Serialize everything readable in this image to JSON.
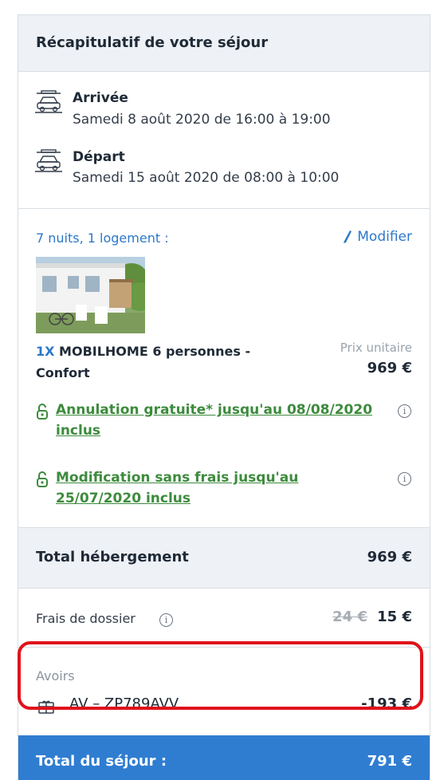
{
  "header": {
    "title": "Récapitulatif de votre séjour"
  },
  "arrival": {
    "label": "Arrivée",
    "value": "Samedi 8 août 2020 de 16:00 à 19:00",
    "icon": "car-arrival-icon"
  },
  "departure": {
    "label": "Départ",
    "value": "Samedi 15 août 2020 de 08:00 à 10:00",
    "icon": "car-departure-icon"
  },
  "stay": {
    "summary": "7 nuits, 1 logement :",
    "modify_label": "Modifier",
    "product_qty": "1X",
    "product_name": "MOBILHOME 6 personnes - Confort",
    "unit_price_label": "Prix unitaire",
    "unit_price": "969 €"
  },
  "conditions": [
    {
      "text": "Annulation gratuite* jusqu'au 08/08/2020 inclus",
      "info": "i"
    },
    {
      "text": "Modification sans frais jusqu'au 25/07/2020 inclus",
      "info": "i"
    }
  ],
  "accommodation_total": {
    "label": "Total hébergement",
    "value": "969 €"
  },
  "fees": {
    "label": "Frais de dossier",
    "info": "i",
    "old_value": "24 €",
    "new_value": "15 €"
  },
  "credits": {
    "label": "Avoirs",
    "code": "AV – ZP789AVV",
    "value": "-193 €",
    "icon": "gift-card-icon"
  },
  "stay_total": {
    "label": "Total du séjour :",
    "value": "791 €"
  },
  "colors": {
    "accent_blue": "#2c78c9",
    "total_bar": "#2f7dd1",
    "green_link": "#3d8b3d",
    "highlight_red": "#e0121b"
  }
}
